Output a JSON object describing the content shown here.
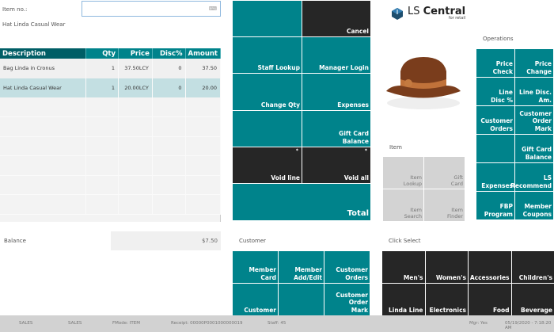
{
  "item_no": {
    "label": "Item no.:",
    "value": "",
    "icon": "keyboard-icon"
  },
  "current_item": "Hat Linda Casual Wear",
  "table": {
    "headers": [
      "Description",
      "Qty",
      "Price",
      "Disc%",
      "Amount"
    ],
    "rows": [
      [
        "Bag Linda in Cronus",
        "1",
        "37.50LCY",
        "0",
        "37.50"
      ],
      [
        "Hat Linda Casual Wear",
        "1",
        "20.00LCY",
        "0",
        "20.00"
      ]
    ],
    "selected_row": 1
  },
  "balance": {
    "label": "Balance",
    "value": "$7.50"
  },
  "main_buttons": [
    "",
    "Cancel",
    "Staff Lookup",
    "Manager Login",
    "Change Qty",
    "Expenses",
    "",
    "Gift Card\nBalance",
    "Void line",
    "Void all",
    "Total"
  ],
  "logo": {
    "name": "LS Central",
    "sub": "for retail",
    "prefix": "LS ",
    "bold": "Central"
  },
  "item": {
    "label": "Item",
    "buttons": [
      "Item\nLookup",
      "Gift\nCard",
      "Item\nSearch",
      "Item\nFinder"
    ]
  },
  "operations": {
    "label": "Operations",
    "buttons": [
      "Price\nCheck",
      "Price\nChange",
      "Line\nDisc %",
      "Line Disc.\nAm.",
      "Customer\nOrders",
      "Customer\nOrder Mark",
      "",
      "Gift Card\nBalance",
      "Expenses",
      "LS\nRecommend",
      "FBP Program",
      "Member\nCoupons"
    ]
  },
  "customer": {
    "label": "Customer",
    "buttons": [
      "Member\nCard",
      "Member\nAdd/Edit",
      "Customer\nOrders",
      "Customer",
      "",
      "Customer\nOrder\nMark"
    ]
  },
  "click_select": {
    "label": "Click Select",
    "buttons": [
      "Men's",
      "Women's",
      "Accessories",
      "Children's",
      "Linda Line",
      "Electronics",
      "Food",
      "Beverage"
    ]
  },
  "status": {
    "s1": "SALES",
    "s2": "SALES",
    "fmode": "FMode: ITEM",
    "receipt": "Receipt: 00000P0001000000019",
    "staff": "Staff: 45",
    "mgr": "Mgr: Yes",
    "datetime": "05/19/2020 - 7:18:20 AM"
  },
  "colors": {
    "teal": "#00838b",
    "dark": "#262626",
    "selected_row": "#c3dfe2"
  }
}
